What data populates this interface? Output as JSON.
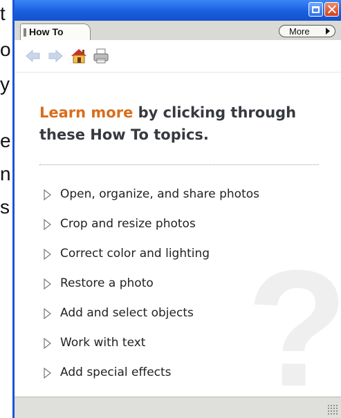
{
  "background_document": {
    "visible_letters": [
      "t",
      "o",
      "y",
      "",
      "e",
      "n",
      "s"
    ]
  },
  "window": {
    "title_buttons": [
      "minimize-icon",
      "close-icon"
    ],
    "colors": {
      "titlebar": "#1a5fe0",
      "accent": "#d86d1c"
    }
  },
  "tab": {
    "label": "How To"
  },
  "more_button": {
    "label": "More"
  },
  "toolbar": {
    "icons": [
      "back-arrow-icon",
      "forward-arrow-icon",
      "home-icon",
      "print-icon"
    ]
  },
  "content": {
    "headline_accent": "Learn more",
    "headline_rest": " by clicking through these How To topics.",
    "watermark": "?",
    "topics": [
      {
        "label": "Open, organize, and share photos"
      },
      {
        "label": "Crop and resize photos"
      },
      {
        "label": "Correct color and lighting"
      },
      {
        "label": "Restore a photo"
      },
      {
        "label": "Add and select objects"
      },
      {
        "label": "Work with text"
      },
      {
        "label": "Add special effects"
      }
    ]
  }
}
